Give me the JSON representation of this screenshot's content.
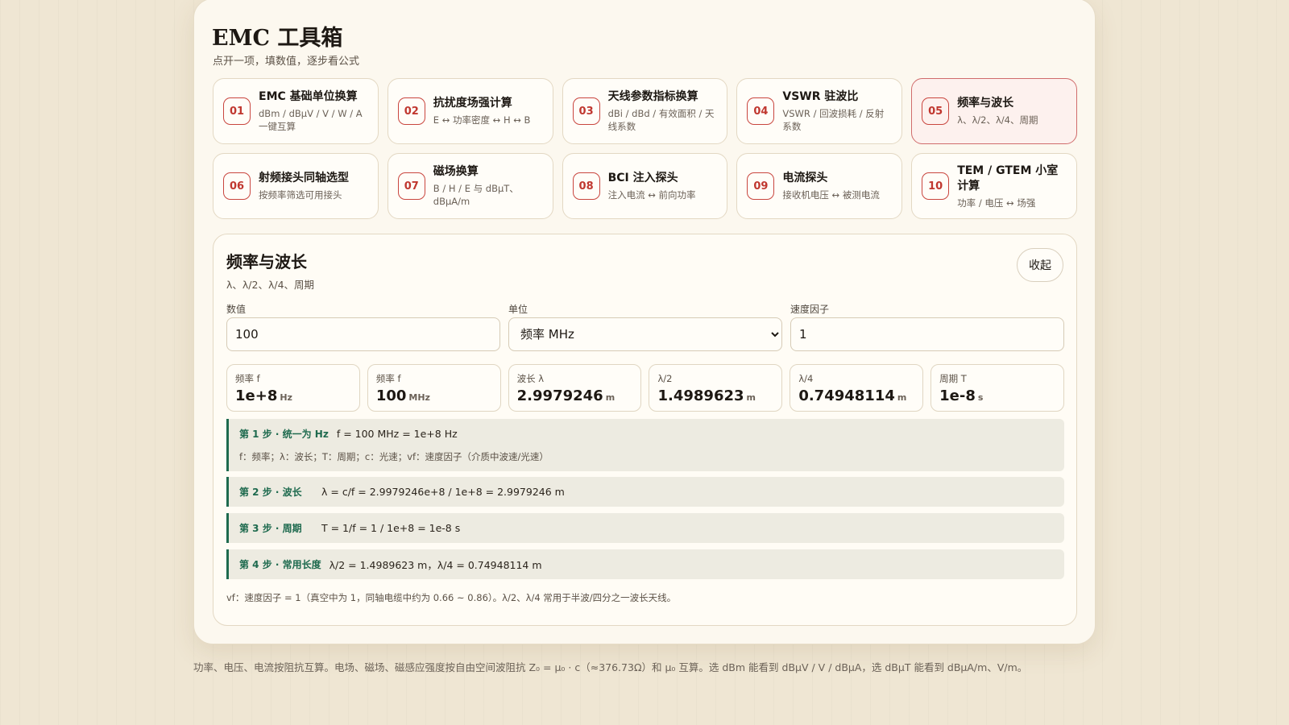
{
  "app": {
    "title": "EMC 工具箱",
    "subtitle": "点开一项，填数值，逐步看公式"
  },
  "tools": [
    {
      "num": "01",
      "name": "EMC 基础单位换算",
      "desc": "dBm / dBμV / V / W / A 一键互算"
    },
    {
      "num": "02",
      "name": "抗扰度场强计算",
      "desc": "E ↔ 功率密度 ↔ H ↔ B"
    },
    {
      "num": "03",
      "name": "天线参数指标换算",
      "desc": "dBi / dBd / 有效面积 / 天线系数"
    },
    {
      "num": "04",
      "name": "VSWR 驻波比",
      "desc": "VSWR / 回波损耗 / 反射系数"
    },
    {
      "num": "05",
      "name": "频率与波长",
      "desc": "λ、λ/2、λ/4、周期"
    },
    {
      "num": "06",
      "name": "射频接头同轴选型",
      "desc": "按频率筛选可用接头"
    },
    {
      "num": "07",
      "name": "磁场换算",
      "desc": "B / H / E 与 dBμT、dBμA/m"
    },
    {
      "num": "08",
      "name": "BCI 注入探头",
      "desc": "注入电流 ↔ 前向功率"
    },
    {
      "num": "09",
      "name": "电流探头",
      "desc": "接收机电压 ↔ 被测电流"
    },
    {
      "num": "10",
      "name": "TEM / GTEM 小室计算",
      "desc": "功率 / 电压 ↔ 场强"
    }
  ],
  "active_tool": "05",
  "detail": {
    "title": "频率与波长",
    "subtitle": "λ、λ/2、λ/4、周期",
    "collapse_label": "收起",
    "fields": {
      "value": {
        "label": "数值",
        "value": "100"
      },
      "unit": {
        "label": "单位",
        "selected": "频率 MHz"
      },
      "vf": {
        "label": "速度因子",
        "value": "1"
      }
    },
    "results": [
      {
        "label": "频率 f",
        "value": "1e+8",
        "unit": "Hz"
      },
      {
        "label": "频率 f",
        "value": "100",
        "unit": "MHz"
      },
      {
        "label": "波长 λ",
        "value": "2.9979246",
        "unit": "m"
      },
      {
        "label": "λ/2",
        "value": "1.4989623",
        "unit": "m"
      },
      {
        "label": "λ/4",
        "value": "0.74948114",
        "unit": "m"
      },
      {
        "label": "周期 T",
        "value": "1e-8",
        "unit": "s"
      }
    ],
    "steps": [
      {
        "tag": "第 1 步 · 统一为 Hz",
        "text": "f = 100 MHz = 1e+8 Hz",
        "note": "f：频率；λ：波长；T：周期；c：光速；vf：速度因子（介质中波速/光速）"
      },
      {
        "tag": "第 2 步 · 波长",
        "text": "λ = c/f = 2.9979246e+8 / 1e+8 = 2.9979246 m"
      },
      {
        "tag": "第 3 步 · 周期",
        "text": "T = 1/f = 1 / 1e+8 = 1e-8 s"
      },
      {
        "tag": "第 4 步 · 常用长度",
        "text": "λ/2 = 1.4989623 m，λ/4 = 0.74948114 m"
      }
    ],
    "footnote": "vf：速度因子 = 1（真空中为 1，同轴电缆中约为 0.66 ~ 0.86）。λ/2、λ/4 常用于半波/四分之一波长天线。"
  },
  "page_note": "功率、电压、电流按阻抗互算。电场、磁场、磁感应强度按自由空间波阻抗 Z₀ = μ₀ · c（≈376.73Ω）和 μ₀ 互算。选 dBm 能看到 dBμV / V / dBμA，选 dBμT 能看到 dBμA/m、V/m。",
  "colors": {
    "accent": "#c0372f",
    "step_accent": "#1e6a4e",
    "panel_bg": "#fcf8ef",
    "page_bg": "#efe6d3"
  }
}
